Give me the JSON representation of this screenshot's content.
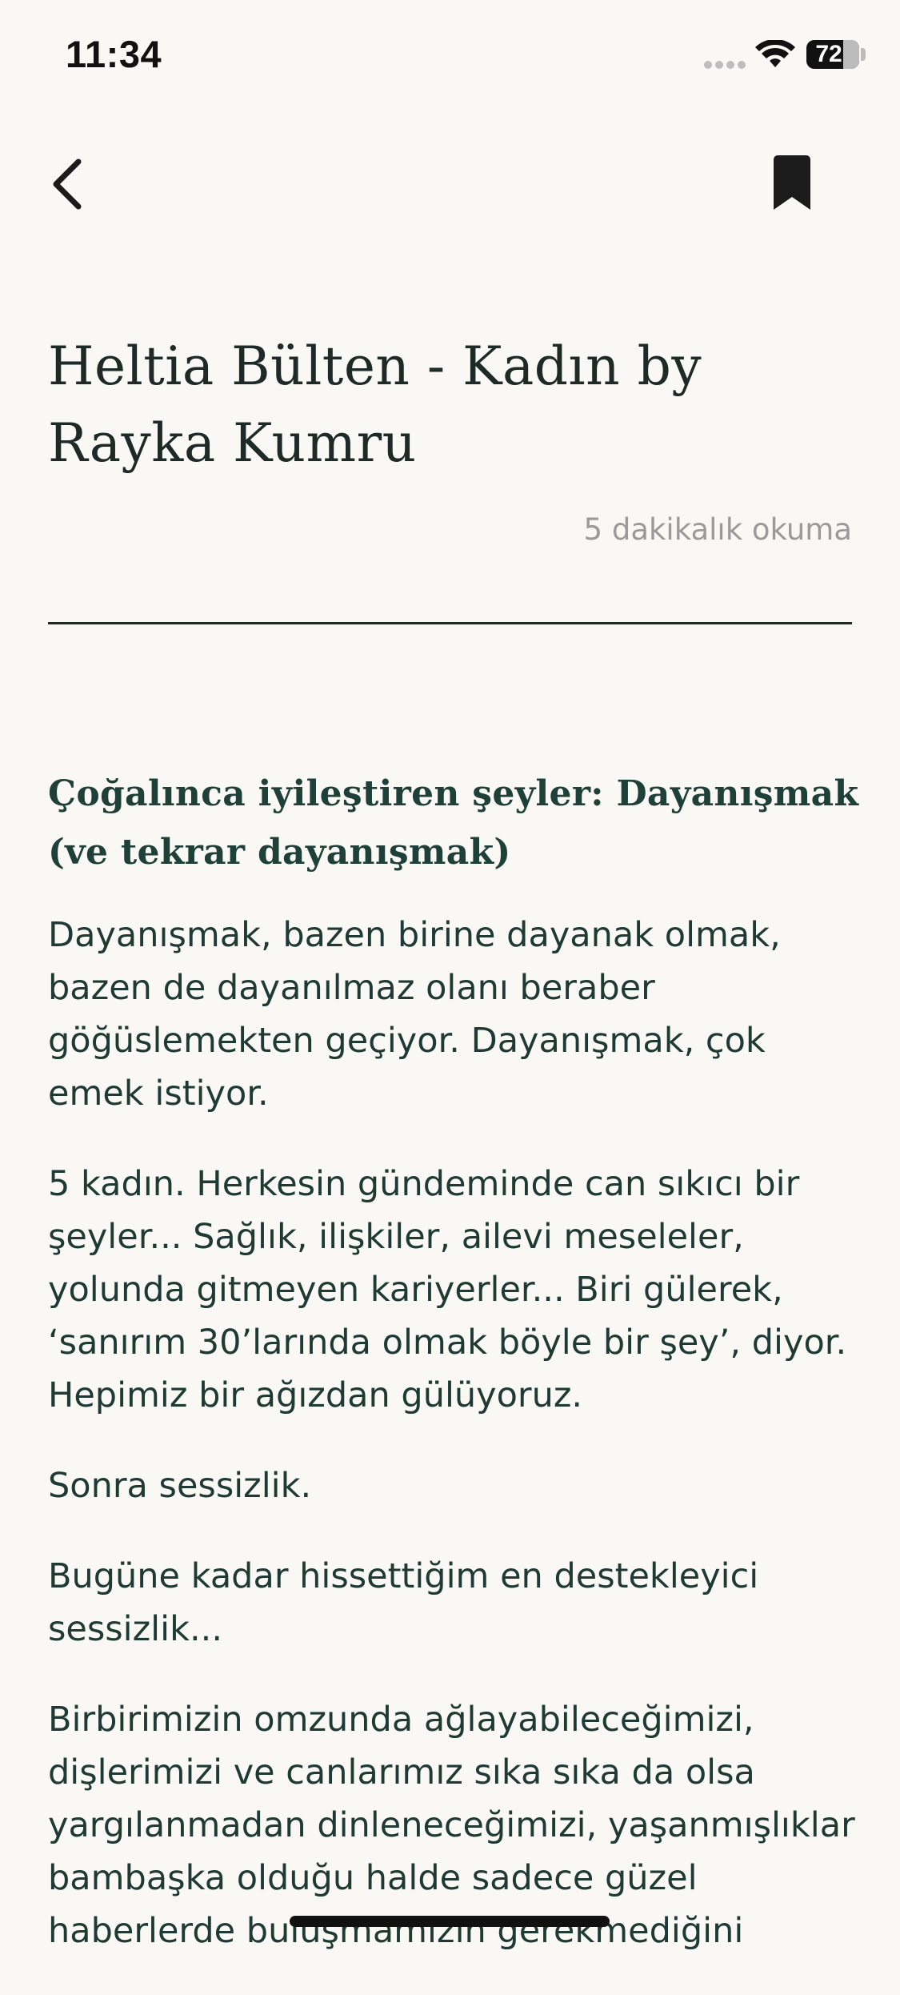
{
  "status_bar": {
    "time": "11:34",
    "battery_level": "72",
    "battery_percent": 72
  },
  "nav": {
    "back_icon": "chevron-left-icon",
    "bookmark_icon": "bookmark-filled-icon"
  },
  "article": {
    "title": "Heltia Bülten - Kadın by Rayka Kumru",
    "reading_time": "5 dakikalık okuma",
    "subheading": "Çoğalınca iyileştiren şeyler: Dayanışmak (ve tekrar dayanışmak)",
    "paragraphs": [
      "Dayanışmak, bazen birine dayanak olmak, bazen de dayanılmaz olanı beraber göğüslemekten geçiyor. Dayanışmak, çok emek istiyor.",
      "5 kadın. Herkesin gündeminde can sıkıcı bir şeyler... Sağlık, ilişkiler, ailevi meseleler, yolunda gitmeyen kariyerler... Biri gülerek, ‘sanırım 30’larında olmak böyle bir şey’, diyor. Hepimiz bir ağızdan gülüyoruz.",
      "Sonra sessizlik.",
      "Bugüne kadar hissettiğim en destekleyici sessizlik...",
      "Birbirimizin omzunda ağlayabileceğimizi, dişlerimizi ve canlarımız sıka sıka da olsa yargılanmadan dinleneceğimizi, yaşanmışlıklar bambaşka olduğu halde sadece güzel haberlerde buluşmamızın gerekmediğini"
    ]
  },
  "colors": {
    "background": "#faf8f4",
    "heading": "#1f4038",
    "body_text": "#1f3a34",
    "muted": "#9a9a9a"
  }
}
